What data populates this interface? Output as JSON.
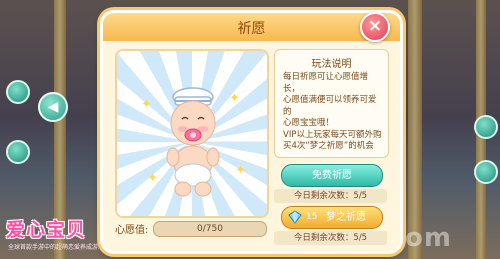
{
  "dialog": {
    "title": "祈愿",
    "close_label": "×"
  },
  "rules": {
    "title": "玩法说明",
    "lines": [
      "每日祈愿可让心愿值增长，",
      "心愿值满便可以领养可爱的",
      "心愿宝宝哦！",
      "VIP以上玩家每天可额外购",
      "买4次“梦之祈愿”的机会"
    ]
  },
  "wish_meter": {
    "label": "心愿值:",
    "current": 0,
    "max": 750,
    "text": "0/750"
  },
  "free_wish": {
    "label": "免费祈愿",
    "remaining_text": "今日剩余次数：5/5"
  },
  "dream_wish": {
    "cost": "15",
    "label": "梦之祈愿",
    "remaining_text": "今日剩余次数：5/5",
    "icon": "diamond-icon"
  },
  "branding": {
    "logo_text": "爱心宝贝",
    "logo_sub": "全球首款手游中的超萌恋爱养成游戏",
    "watermark": "87G.com"
  },
  "colors": {
    "dialog_bg": "#fff6dd",
    "title_bar": "#f7b94f",
    "free_button": "#2fb9a5",
    "wish_button": "#f2ac2f",
    "close_button": "#e03d55"
  }
}
